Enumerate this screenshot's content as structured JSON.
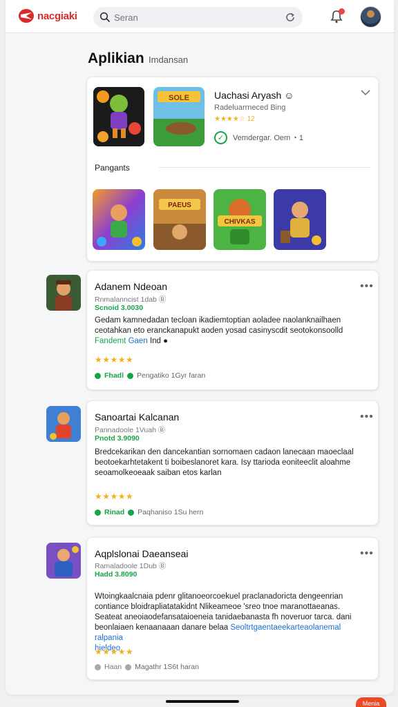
{
  "header": {
    "logo_text": "nacgiaki",
    "search_placeholder": "Seran"
  },
  "page": {
    "title": "Aplikian",
    "subtitle": "Imdansan"
  },
  "featured": {
    "title": "Uachasi Aryash ☺",
    "subtitle": "Radeluarrneced Bing",
    "rating_text": "★★★★☆ 12",
    "verify_text": "Vemdergar.  Oem  ◔ 1",
    "tile_banner_text": "SOLE",
    "section_label": "Pangants",
    "grid_tiles": [
      {
        "label": "",
        "color": "#6b39c4"
      },
      {
        "label": "PAEUS",
        "color": "#8f5a2a"
      },
      {
        "label": "CHIVKAS",
        "color": "#3fa23a"
      },
      {
        "label": "",
        "color": "#3b3aa6"
      }
    ]
  },
  "apps": [
    {
      "name": "Adanem Ndeoan",
      "dev": "Rnmalanncist 1dab Ⓑ",
      "price": "Scnoid 3.0030",
      "desc_line1": "Gedam kamnedadan tecloan ikadiemtoptian aoladee naolanknailhaen",
      "desc_line2": "ceotahkan eto eranckanapukt aoden yosad casinyscdit seotokonsoolld",
      "desc_line3_a": "Fandemt",
      "desc_line3_b": "Gaen",
      "desc_line3_c": "Ind ●",
      "stars": "★★★★★",
      "status_label": "Fhadl",
      "status_text": "Pengatiko 1Gyr faran"
    },
    {
      "name": "Sanoartai Kalcanan",
      "dev": "Pannadoole 1Vuah Ⓑ",
      "price": "Pnotd 3.9090",
      "desc_line1": "Bredcekarikan den dancekantian sornomaen cadaon lanecaan maoeclaal",
      "desc_line2": "beotoekarhtetakent ti boibeslanoret kara. Isy ttarioda eoniteeclit aloahme",
      "desc_line3": "seoamolkeoeaak saiban etos karlan",
      "stars": "★★★★★",
      "status_label": "Rinad",
      "status_text": "Paqhaniso 1Su hern"
    },
    {
      "name": "Aqplslonai Daeanseai",
      "dev": "Ramaladoole 1Dub Ⓑ",
      "price": "Hadd 3.8090",
      "desc_line1": "Wtoingkaalcnaia pdenr glitanoeorcoekuel praclanadoricta dengeenrian",
      "desc_line2": "contiance bloidrapliatatakidnt Nlikeameoe 'sreo tnoe maranottaeanas.",
      "desc_line3": "Seateat aneoiaodefansataioeneia tanidaebanasta fh noveruor tarca. dani",
      "desc_line4_a": "beonlaiaen kenaanaaan danare belaa",
      "desc_line4_b": "Seoltrtgaentaeekarteaolanemal ralpania",
      "desc_line5": "hieldeo.",
      "stars": "★★★★★",
      "status_label": "Haan",
      "status_text": "Magathr 1S6t haran"
    }
  ],
  "footer": {
    "menu_label": "Menia"
  },
  "colors": {
    "brand": "#d92b2b",
    "accent_green": "#17a34a",
    "star": "#f2b01e",
    "link": "#1d6fd1"
  },
  "icons": [
    "logo-icon",
    "search-icon",
    "refresh-icon",
    "bell-icon",
    "chevron-down-icon",
    "check-icon",
    "more-icon",
    "info-icon"
  ]
}
